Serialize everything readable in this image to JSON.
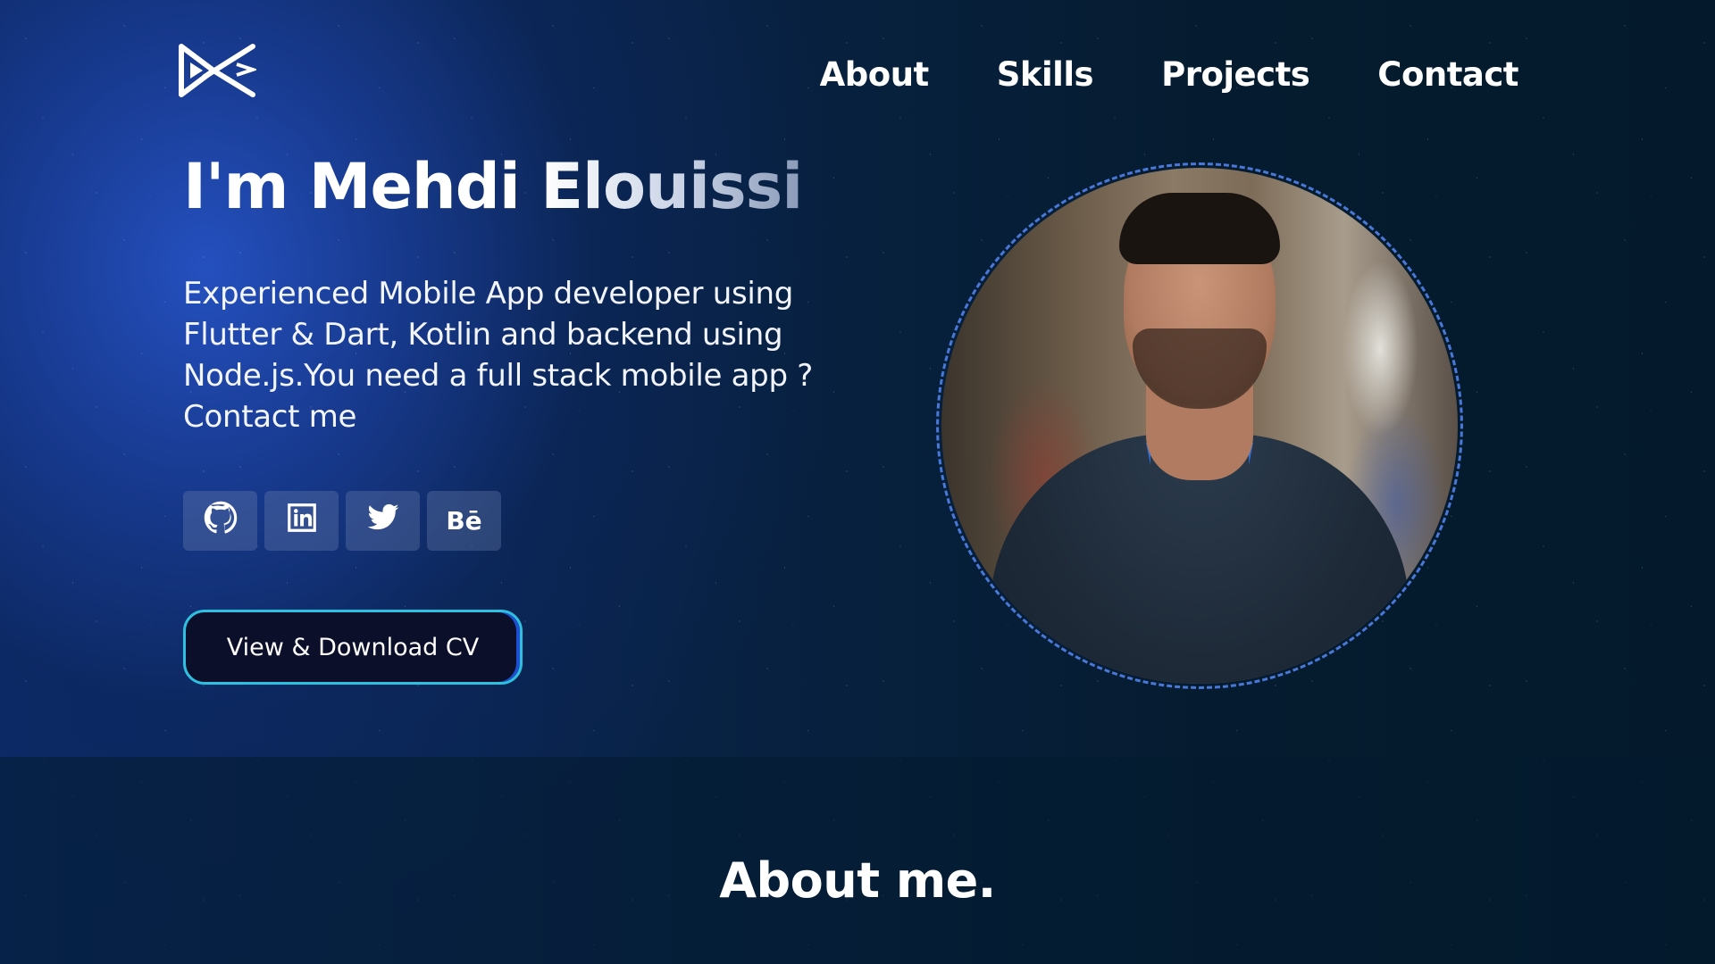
{
  "nav": {
    "items": [
      {
        "label": "About"
      },
      {
        "label": "Skills"
      },
      {
        "label": "Projects"
      },
      {
        "label": "Contact"
      }
    ]
  },
  "hero": {
    "title_first": "I'm Mehdi",
    "title_last": "Elouissi",
    "description": "Experienced Mobile App developer using Flutter & Dart, Kotlin and backend using Node.js.You need a full stack mobile app ? Contact me",
    "socials": [
      {
        "icon": "github-icon"
      },
      {
        "icon": "linkedin-icon"
      },
      {
        "icon": "twitter-icon"
      },
      {
        "icon": "behance-icon",
        "label": "Bē"
      }
    ],
    "cv_button_label": "View & Download CV"
  },
  "about": {
    "heading": "About me."
  },
  "colors": {
    "accent_border": "#2fc0e0",
    "button_bg": "#0b0f2a",
    "portrait_ring": "#4a78d8",
    "glow": "#2652c4"
  }
}
